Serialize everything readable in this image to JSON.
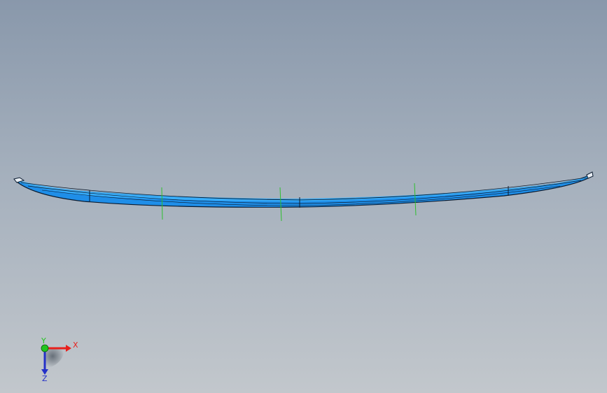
{
  "viewport": {
    "background_top": "#8998ab",
    "background_bottom": "#c2c7cc"
  },
  "model": {
    "part_color": "#1f8ee8",
    "part_highlight": "#3db4ff",
    "edge_color": "#0a1a2e",
    "centerline_color": "#2ec02e"
  },
  "triad": {
    "x_label": "X",
    "y_label": "Y",
    "z_label": "Z",
    "x_color": "#e8201c",
    "y_color": "#22c41e",
    "z_color": "#2430c8"
  }
}
